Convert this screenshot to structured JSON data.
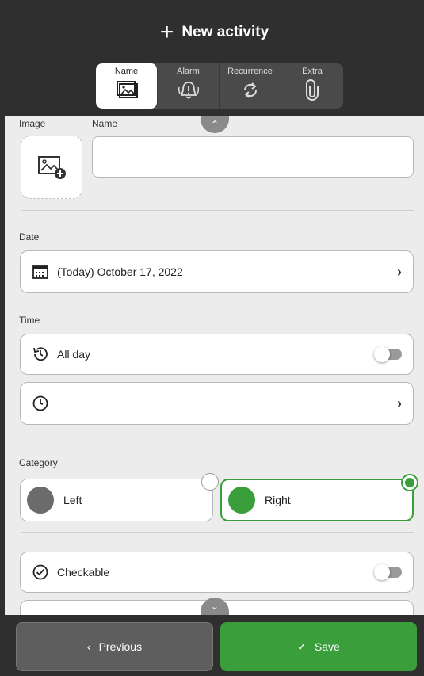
{
  "header": {
    "title": "New activity",
    "tabs": [
      {
        "label": "Name",
        "icon": "image-icon",
        "active": true
      },
      {
        "label": "Alarm",
        "icon": "bell-alert-icon",
        "active": false
      },
      {
        "label": "Recurrence",
        "icon": "repeat-icon",
        "active": false
      },
      {
        "label": "Extra",
        "icon": "paperclip-icon",
        "active": false
      }
    ]
  },
  "form": {
    "image_label": "Image",
    "name_label": "Name",
    "name_value": "",
    "date_label": "Date",
    "date_value": "(Today) October 17, 2022",
    "time_label": "Time",
    "all_day_label": "All day",
    "all_day_on": false,
    "time_value": "",
    "category_label": "Category",
    "categories": [
      {
        "label": "Left",
        "color": "#6b6b6b",
        "selected": false
      },
      {
        "label": "Right",
        "color": "#3a9e3a",
        "selected": true
      }
    ],
    "checkable_label": "Checkable",
    "checkable_on": false
  },
  "footer": {
    "previous_label": "Previous",
    "save_label": "Save"
  },
  "colors": {
    "accent": "#3a9e3a",
    "dark_bg": "#2f2f2f",
    "content_bg": "#ececec"
  }
}
